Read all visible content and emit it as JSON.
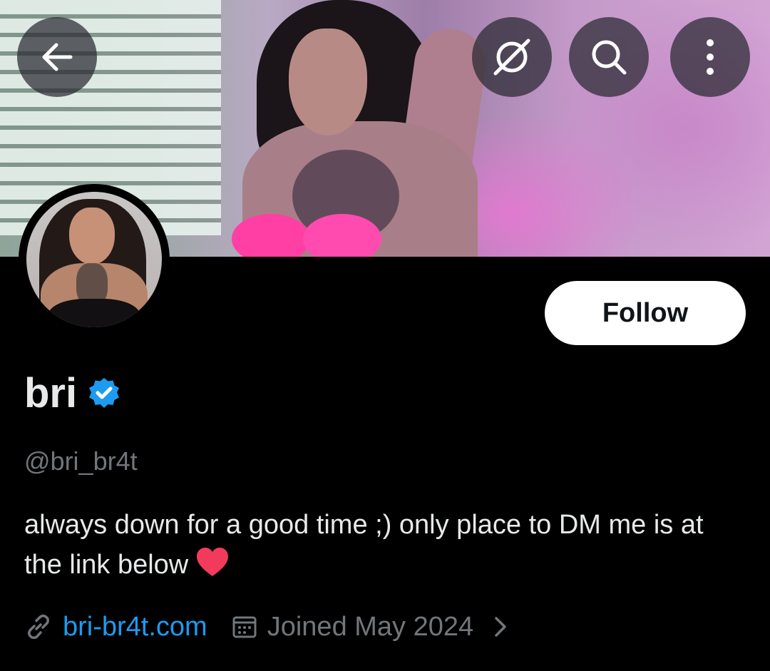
{
  "header": {
    "back_icon": "arrow-left-icon",
    "grok_icon": "grok-icon",
    "search_icon": "search-icon",
    "more_icon": "more-vertical-icon"
  },
  "profile": {
    "name": "bri",
    "verified": true,
    "verified_color": "#1d9bf0",
    "handle": "@bri_br4t",
    "bio": "always down for a good time ;) only place to DM me is at the link below",
    "bio_emoji": "heart",
    "website": "bri-br4t.com",
    "joined": "Joined May 2024",
    "follow_label": "Follow"
  },
  "colors": {
    "background": "#000000",
    "text_primary": "#e7e9ea",
    "text_secondary": "#71767b",
    "link": "#1d9bf0",
    "follow_button_bg": "#ffffff"
  }
}
